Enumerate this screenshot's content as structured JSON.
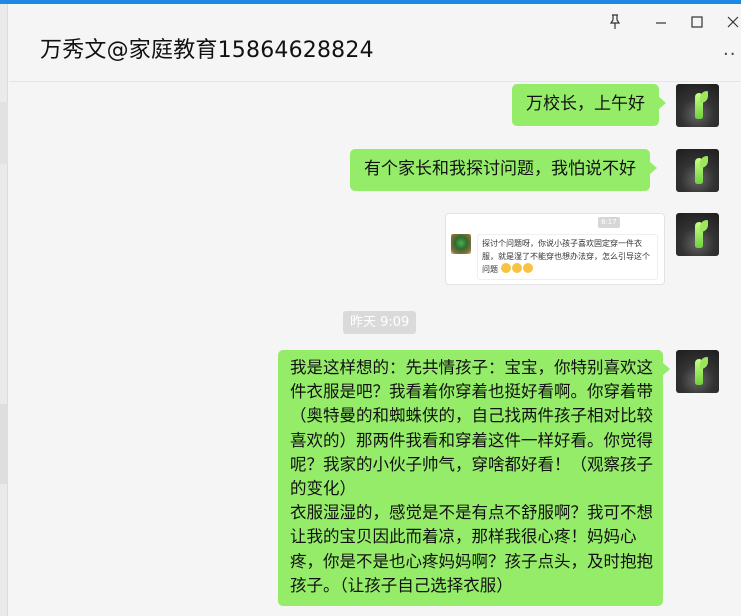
{
  "window": {
    "title": "万秀文@家庭教育15864628824",
    "controls": {
      "pin_icon": "pin-icon",
      "minimize_icon": "minimize-icon",
      "maximize_icon": "maximize-icon",
      "close_icon": "close-icon",
      "more_label": "··"
    }
  },
  "messages": [
    {
      "text": "万校长，上午好"
    },
    {
      "text": "有个家长和我探讨问题，我怕说不好"
    },
    {
      "type": "image",
      "image": {
        "time": "8:17",
        "text": "探讨个问题呀，你说小孩子喜欢固定穿一件衣服，就是湿了不能穿也想办法穿，怎么引导这个问题"
      }
    },
    {
      "type": "timestamp",
      "text": "昨天 9:09"
    },
    {
      "text": "我是这样想的：先共情孩子：宝宝，你特别喜欢这件衣服是吧？我看着你穿着也挺好看啊。你穿着带（奥特曼的和蜘蛛侠的，自己找两件孩子相对比较喜欢的）那两件我看和穿着这件一样好看。你觉得呢？我家的小伙子帅气，穿啥都好看！（观察孩子的变化）\n衣服湿湿的，感觉是不是有点不舒服啊？我可不想让我的宝贝因此而着凉，那样我很心疼！妈妈心疼，你是不是也心疼妈妈啊？孩子点头，及时抱抱孩子。（让孩子自己选择衣服）"
    }
  ],
  "colors": {
    "bubble": "#95ec69",
    "background": "#f5f5f5",
    "accent": "#1e88e5"
  }
}
